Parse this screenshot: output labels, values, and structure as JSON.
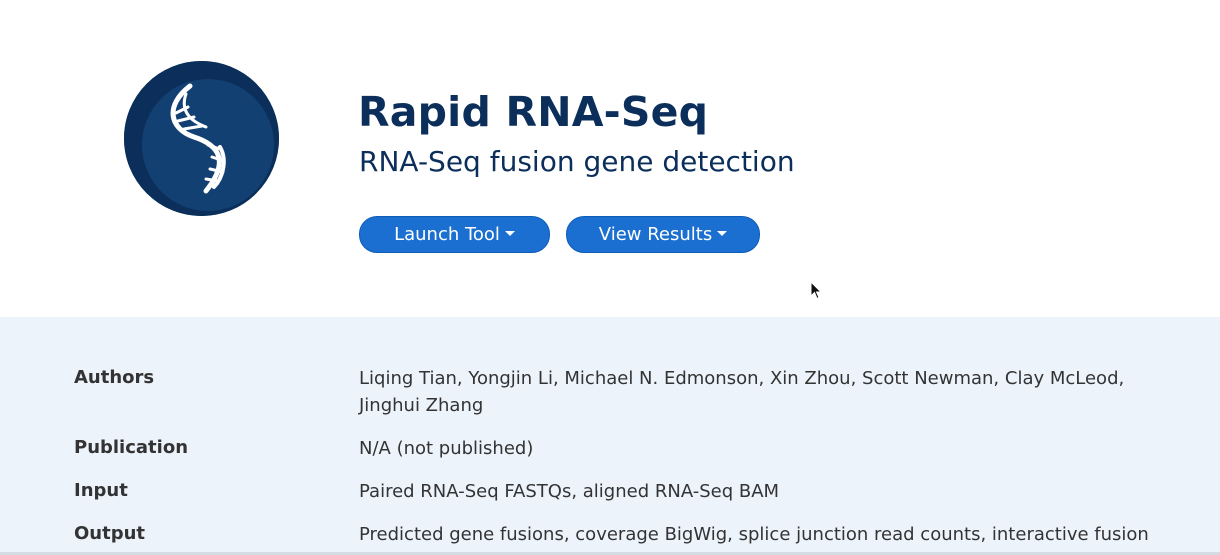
{
  "header": {
    "title": "Rapid RNA-Seq",
    "subtitle": "RNA-Seq fusion gene detection",
    "logo_icon": "dna-helix-icon",
    "brand_color": "#0b2f5a",
    "button_color": "#1a6fd1"
  },
  "actions": {
    "launch_label": "Launch Tool",
    "results_label": "View Results"
  },
  "details": {
    "authors_label": "Authors",
    "authors_value": "Liqing Tian, Yongjin Li, Michael N. Edmonson, Xin Zhou, Scott Newman, Clay McLeod, Jinghui Zhang",
    "publication_label": "Publication",
    "publication_value": "N/A (not published)",
    "input_label": "Input",
    "input_value": "Paired RNA-Seq FASTQs, aligned RNA-Seq BAM",
    "output_label": "Output",
    "output_value": "Predicted gene fusions, coverage BigWig, splice junction read counts, interactive fusion gene"
  }
}
